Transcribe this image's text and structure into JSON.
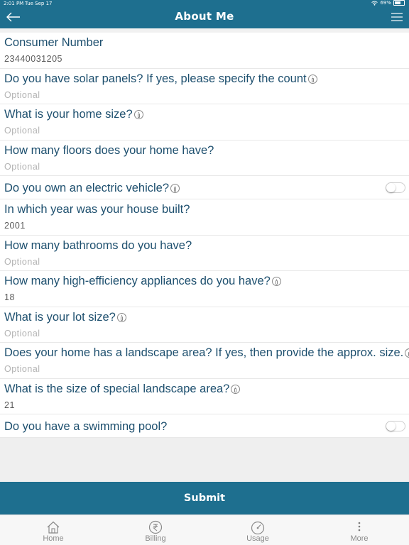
{
  "status_bar": {
    "time": "2:01 PM",
    "date": "Tue Sep 17",
    "battery": "69%",
    "battery_level": 0.69
  },
  "header": {
    "title": "About Me",
    "back_icon": "arrow-left-icon",
    "menu_icon": "hamburger-menu-icon",
    "background_color": "#1e6f8f"
  },
  "form": {
    "fields": [
      {
        "question": "Consumer Number",
        "value": "23440031205"
      },
      {
        "question": "Do you have solar panels? If yes, please specify the count",
        "placeholder": "Optional",
        "info": true
      },
      {
        "question": "What is your home size?",
        "placeholder": "Optional",
        "info": true
      },
      {
        "question": "How many floors does your home have?",
        "placeholder": "Optional"
      },
      {
        "question": "Do you own an electric vehicle?",
        "toggle": false,
        "info": true
      },
      {
        "question": "In which year was your house built?",
        "value": "2001"
      },
      {
        "question": "How many bathrooms do you have?",
        "placeholder": "Optional"
      },
      {
        "question": "How many high-efficiency appliances do you have?",
        "value": "18",
        "info": true
      },
      {
        "question": "What is your lot size?",
        "placeholder": "Optional",
        "info": true
      },
      {
        "question": "Does your home has a landscape area? If yes, then provide the approx. size.",
        "placeholder": "Optional",
        "info": true
      },
      {
        "question": "What is the size of special landscape area?",
        "value": "21",
        "info": true
      },
      {
        "question": "Do you have a swimming pool?",
        "toggle": false
      }
    ]
  },
  "submit": {
    "label": "Submit"
  },
  "tabbar": {
    "tabs": [
      {
        "label": "Home",
        "icon": "home-icon"
      },
      {
        "label": "Billing",
        "icon": "rupee-icon"
      },
      {
        "label": "Usage",
        "icon": "gauge-icon"
      },
      {
        "label": "More",
        "icon": "more-vertical-icon"
      }
    ]
  },
  "colors": {
    "accent": "#1e6f8f",
    "question_text": "#1d4f6e",
    "placeholder_text": "#b3b3b3"
  }
}
